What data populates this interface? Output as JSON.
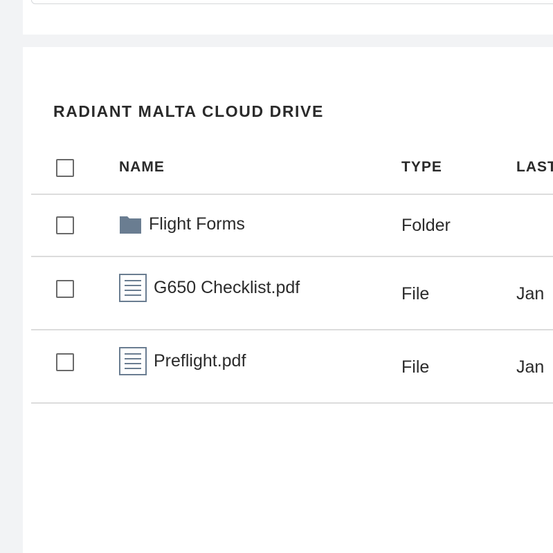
{
  "drive": {
    "title": "RADIANT MALTA CLOUD DRIVE"
  },
  "table": {
    "columns": {
      "name": "NAME",
      "type": "TYPE",
      "last": "LAST"
    },
    "rows": [
      {
        "name": "Flight Forms",
        "type": "Folder",
        "last": "",
        "icon": "folder-icon"
      },
      {
        "name": "G650 Checklist.pdf",
        "type": "File",
        "last": "Jan",
        "icon": "document-icon"
      },
      {
        "name": "Preflight.pdf",
        "type": "File",
        "last": "Jan",
        "icon": "document-icon"
      }
    ]
  },
  "colors": {
    "icon": "#6a7d91",
    "divider": "#dcdcdc",
    "background": "#f2f3f5"
  }
}
